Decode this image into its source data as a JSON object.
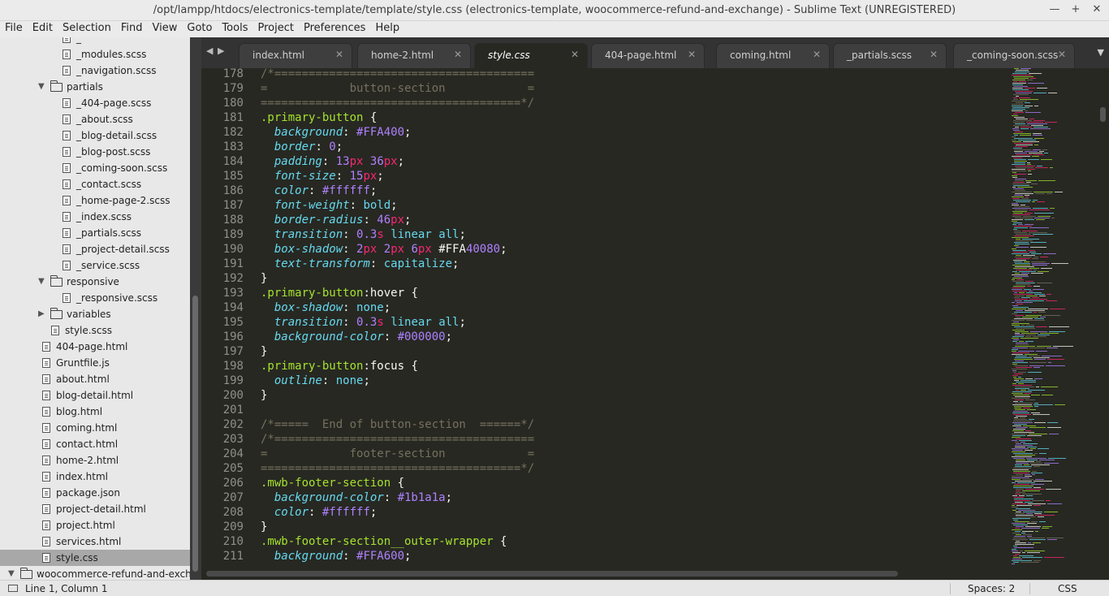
{
  "window": {
    "title": "/opt/lampp/htdocs/electronics-template/template/style.css (electronics-template, woocommerce-refund-and-exchange) - Sublime Text (UNREGISTERED)",
    "controls": [
      "—",
      "+",
      "✕"
    ]
  },
  "menu": [
    "File",
    "Edit",
    "Selection",
    "Find",
    "View",
    "Goto",
    "Tools",
    "Project",
    "Preferences",
    "Help"
  ],
  "sidebar": {
    "rows": [
      {
        "type": "file",
        "label": "_",
        "indent": 2
      },
      {
        "type": "file",
        "label": "_modules.scss",
        "indent": 2
      },
      {
        "type": "file",
        "label": "_navigation.scss",
        "indent": 2
      },
      {
        "type": "folder",
        "label": "partials",
        "indent": 1,
        "open": true
      },
      {
        "type": "file",
        "label": "_404-page.scss",
        "indent": 2
      },
      {
        "type": "file",
        "label": "_about.scss",
        "indent": 2
      },
      {
        "type": "file",
        "label": "_blog-detail.scss",
        "indent": 2
      },
      {
        "type": "file",
        "label": "_blog-post.scss",
        "indent": 2
      },
      {
        "type": "file",
        "label": "_coming-soon.scss",
        "indent": 2
      },
      {
        "type": "file",
        "label": "_contact.scss",
        "indent": 2
      },
      {
        "type": "file",
        "label": "_home-page-2.scss",
        "indent": 2
      },
      {
        "type": "file",
        "label": "_index.scss",
        "indent": 2
      },
      {
        "type": "file",
        "label": "_partials.scss",
        "indent": 2
      },
      {
        "type": "file",
        "label": "_project-detail.scss",
        "indent": 2
      },
      {
        "type": "file",
        "label": "_service.scss",
        "indent": 2
      },
      {
        "type": "folder",
        "label": "responsive",
        "indent": 1,
        "open": true
      },
      {
        "type": "file",
        "label": "_responsive.scss",
        "indent": 2
      },
      {
        "type": "folder",
        "label": "variables",
        "indent": 1,
        "open": false
      },
      {
        "type": "file",
        "label": "style.scss",
        "indent": 1
      },
      {
        "type": "file",
        "label": "404-page.html",
        "indent": 0
      },
      {
        "type": "file",
        "label": "Gruntfile.js",
        "indent": 0
      },
      {
        "type": "file",
        "label": "about.html",
        "indent": 0
      },
      {
        "type": "file",
        "label": "blog-detail.html",
        "indent": 0
      },
      {
        "type": "file",
        "label": "blog.html",
        "indent": 0
      },
      {
        "type": "file",
        "label": "coming.html",
        "indent": 0
      },
      {
        "type": "file",
        "label": "contact.html",
        "indent": 0
      },
      {
        "type": "file",
        "label": "home-2.html",
        "indent": 0
      },
      {
        "type": "file",
        "label": "index.html",
        "indent": 0
      },
      {
        "type": "file",
        "label": "package.json",
        "indent": 0
      },
      {
        "type": "file",
        "label": "project-detail.html",
        "indent": 0
      },
      {
        "type": "file",
        "label": "project.html",
        "indent": 0
      },
      {
        "type": "file",
        "label": "services.html",
        "indent": 0
      },
      {
        "type": "file",
        "label": "style.css",
        "indent": 0,
        "selected": true
      },
      {
        "type": "folder",
        "label": "woocommerce-refund-and-excha",
        "indent": -1,
        "open": true
      }
    ]
  },
  "tabs": [
    {
      "label": "index.html",
      "active": false
    },
    {
      "label": "home-2.html",
      "active": false
    },
    {
      "label": "style.css",
      "active": true
    },
    {
      "label": "404-page.html",
      "active": false
    },
    {
      "label": "coming.html",
      "active": false
    },
    {
      "label": "_partials.scss",
      "active": false
    },
    {
      "label": "_coming-soon.scss",
      "active": false
    }
  ],
  "editor": {
    "lines": [
      {
        "n": "178",
        "t": [
          [
            "cm",
            "/*======================================"
          ]
        ]
      },
      {
        "n": "179",
        "t": [
          [
            "cm",
            "=            button-section            ="
          ]
        ]
      },
      {
        "n": "180",
        "t": [
          [
            "cm",
            "======================================*/"
          ]
        ]
      },
      {
        "n": "181",
        "t": [
          [
            "sel",
            ".primary-button"
          ],
          [
            "ps",
            " {"
          ]
        ]
      },
      {
        "n": "182",
        "t": [
          [
            "ps",
            "  "
          ],
          [
            "prop",
            "background"
          ],
          [
            "ps",
            ": "
          ],
          [
            "num",
            "#FFA400"
          ],
          [
            "ps",
            ";"
          ]
        ]
      },
      {
        "n": "183",
        "t": [
          [
            "ps",
            "  "
          ],
          [
            "prop",
            "border"
          ],
          [
            "ps",
            ": "
          ],
          [
            "num",
            "0"
          ],
          [
            "ps",
            ";"
          ]
        ]
      },
      {
        "n": "184",
        "t": [
          [
            "ps",
            "  "
          ],
          [
            "prop",
            "padding"
          ],
          [
            "ps",
            ": "
          ],
          [
            "num",
            "13"
          ],
          [
            "unit",
            "px"
          ],
          [
            "ps",
            " "
          ],
          [
            "num",
            "36"
          ],
          [
            "unit",
            "px"
          ],
          [
            "ps",
            ";"
          ]
        ]
      },
      {
        "n": "185",
        "t": [
          [
            "ps",
            "  "
          ],
          [
            "prop",
            "font-size"
          ],
          [
            "ps",
            ": "
          ],
          [
            "num",
            "15"
          ],
          [
            "unit",
            "px"
          ],
          [
            "ps",
            ";"
          ]
        ]
      },
      {
        "n": "186",
        "t": [
          [
            "ps",
            "  "
          ],
          [
            "prop",
            "color"
          ],
          [
            "ps",
            ": "
          ],
          [
            "num",
            "#ffffff"
          ],
          [
            "ps",
            ";"
          ]
        ]
      },
      {
        "n": "187",
        "t": [
          [
            "ps",
            "  "
          ],
          [
            "prop",
            "font-weight"
          ],
          [
            "ps",
            ": "
          ],
          [
            "kw",
            "bold"
          ],
          [
            "ps",
            ";"
          ]
        ]
      },
      {
        "n": "188",
        "t": [
          [
            "ps",
            "  "
          ],
          [
            "prop",
            "border-radius"
          ],
          [
            "ps",
            ": "
          ],
          [
            "num",
            "46"
          ],
          [
            "unit",
            "px"
          ],
          [
            "ps",
            ";"
          ]
        ]
      },
      {
        "n": "189",
        "t": [
          [
            "ps",
            "  "
          ],
          [
            "prop",
            "transition"
          ],
          [
            "ps",
            ": "
          ],
          [
            "num",
            "0.3"
          ],
          [
            "unit",
            "s"
          ],
          [
            "ps",
            " "
          ],
          [
            "kw",
            "linear"
          ],
          [
            "ps",
            " "
          ],
          [
            "kw",
            "all"
          ],
          [
            "ps",
            ";"
          ]
        ]
      },
      {
        "n": "190",
        "t": [
          [
            "ps",
            "  "
          ],
          [
            "prop",
            "box-shadow"
          ],
          [
            "ps",
            ": "
          ],
          [
            "num",
            "2"
          ],
          [
            "unit",
            "px"
          ],
          [
            "ps",
            " "
          ],
          [
            "num",
            "2"
          ],
          [
            "unit",
            "px"
          ],
          [
            "ps",
            " "
          ],
          [
            "num",
            "6"
          ],
          [
            "unit",
            "px"
          ],
          [
            "ps",
            " #FFA"
          ],
          [
            "num",
            "40080"
          ],
          [
            "ps",
            ";"
          ]
        ]
      },
      {
        "n": "191",
        "t": [
          [
            "ps",
            "  "
          ],
          [
            "prop",
            "text-transform"
          ],
          [
            "ps",
            ": "
          ],
          [
            "kw",
            "capitalize"
          ],
          [
            "ps",
            ";"
          ]
        ]
      },
      {
        "n": "192",
        "t": [
          [
            "ps",
            "}"
          ]
        ]
      },
      {
        "n": "193",
        "t": [
          [
            "sel",
            ".primary-button"
          ],
          [
            "ps",
            ":hover {"
          ]
        ]
      },
      {
        "n": "194",
        "t": [
          [
            "ps",
            "  "
          ],
          [
            "prop",
            "box-shadow"
          ],
          [
            "ps",
            ": "
          ],
          [
            "kw",
            "none"
          ],
          [
            "ps",
            ";"
          ]
        ]
      },
      {
        "n": "195",
        "t": [
          [
            "ps",
            "  "
          ],
          [
            "prop",
            "transition"
          ],
          [
            "ps",
            ": "
          ],
          [
            "num",
            "0.3"
          ],
          [
            "unit",
            "s"
          ],
          [
            "ps",
            " "
          ],
          [
            "kw",
            "linear"
          ],
          [
            "ps",
            " "
          ],
          [
            "kw",
            "all"
          ],
          [
            "ps",
            ";"
          ]
        ]
      },
      {
        "n": "196",
        "t": [
          [
            "ps",
            "  "
          ],
          [
            "prop",
            "background-color"
          ],
          [
            "ps",
            ": "
          ],
          [
            "num",
            "#000000"
          ],
          [
            "ps",
            ";"
          ]
        ]
      },
      {
        "n": "197",
        "t": [
          [
            "ps",
            "}"
          ]
        ]
      },
      {
        "n": "198",
        "t": [
          [
            "sel",
            ".primary-button"
          ],
          [
            "ps",
            ":focus {"
          ]
        ]
      },
      {
        "n": "199",
        "t": [
          [
            "ps",
            "  "
          ],
          [
            "prop",
            "outline"
          ],
          [
            "ps",
            ": "
          ],
          [
            "kw",
            "none"
          ],
          [
            "ps",
            ";"
          ]
        ]
      },
      {
        "n": "200",
        "t": [
          [
            "ps",
            "}"
          ]
        ]
      },
      {
        "n": "201",
        "t": []
      },
      {
        "n": "202",
        "t": [
          [
            "cm",
            "/*=====  End of button-section  ======*/"
          ]
        ]
      },
      {
        "n": "203",
        "t": [
          [
            "cm",
            "/*======================================"
          ]
        ]
      },
      {
        "n": "204",
        "t": [
          [
            "cm",
            "=            footer-section            ="
          ]
        ]
      },
      {
        "n": "205",
        "t": [
          [
            "cm",
            "======================================*/"
          ]
        ]
      },
      {
        "n": "206",
        "t": [
          [
            "sel",
            ".mwb-footer-section"
          ],
          [
            "ps",
            " {"
          ]
        ]
      },
      {
        "n": "207",
        "t": [
          [
            "ps",
            "  "
          ],
          [
            "prop",
            "background-color"
          ],
          [
            "ps",
            ": "
          ],
          [
            "num",
            "#1b1a1a"
          ],
          [
            "ps",
            ";"
          ]
        ]
      },
      {
        "n": "208",
        "t": [
          [
            "ps",
            "  "
          ],
          [
            "prop",
            "color"
          ],
          [
            "ps",
            ": "
          ],
          [
            "num",
            "#ffffff"
          ],
          [
            "ps",
            ";"
          ]
        ]
      },
      {
        "n": "209",
        "t": [
          [
            "ps",
            "}"
          ]
        ]
      },
      {
        "n": "210",
        "t": [
          [
            "sel",
            ".mwb-footer-section__outer-wrapper"
          ],
          [
            "ps",
            " {"
          ]
        ]
      },
      {
        "n": "211",
        "t": [
          [
            "ps",
            "  "
          ],
          [
            "prop",
            "background"
          ],
          [
            "ps",
            ": "
          ],
          [
            "num",
            "#FFA600"
          ],
          [
            "ps",
            ";"
          ]
        ]
      }
    ]
  },
  "status": {
    "position": "Line 1, Column 1",
    "indentation": "Spaces: 2",
    "syntax": "CSS"
  },
  "colors": {
    "editor_bg": "#272822",
    "comment": "#75715e",
    "selector": "#a6e22e",
    "property": "#66d9ef",
    "number": "#ae81ff",
    "unit": "#f92672",
    "sidebar_bg": "#e8e8e8",
    "sidebar_selected": "#a8a8a8"
  }
}
